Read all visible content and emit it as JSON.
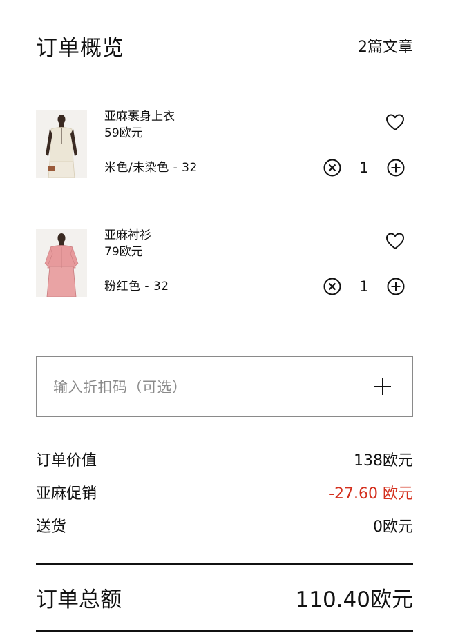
{
  "header": {
    "title": "订单概览",
    "item_count": "2篇文章"
  },
  "items": [
    {
      "name": "亚麻裹身上衣",
      "price": "59欧元",
      "variant": "米色/未染色 - 32",
      "quantity": "1",
      "garment_color": "#ece6d6"
    },
    {
      "name": "亚麻衬衫",
      "price": "79欧元",
      "variant": "粉红色 - 32",
      "quantity": "1",
      "garment_color": "#e79a9c"
    }
  ],
  "discount": {
    "placeholder": "输入折扣码（可选）"
  },
  "summary": {
    "order_value_label": "订单价值",
    "order_value": "138欧元",
    "promo_label": "亚麻促销",
    "promo_value": "-27.60 欧元",
    "shipping_label": "送货",
    "shipping_value": "0欧元",
    "total_label": "订单总额",
    "total_value": "110.40欧元"
  },
  "colors": {
    "text": "#111111",
    "discount_red": "#d4301e",
    "placeholder_gray": "#8b8b8b",
    "divider": "#dedede"
  },
  "icons": [
    "heart-icon",
    "remove-icon",
    "plus-circle-icon",
    "plus-icon"
  ]
}
